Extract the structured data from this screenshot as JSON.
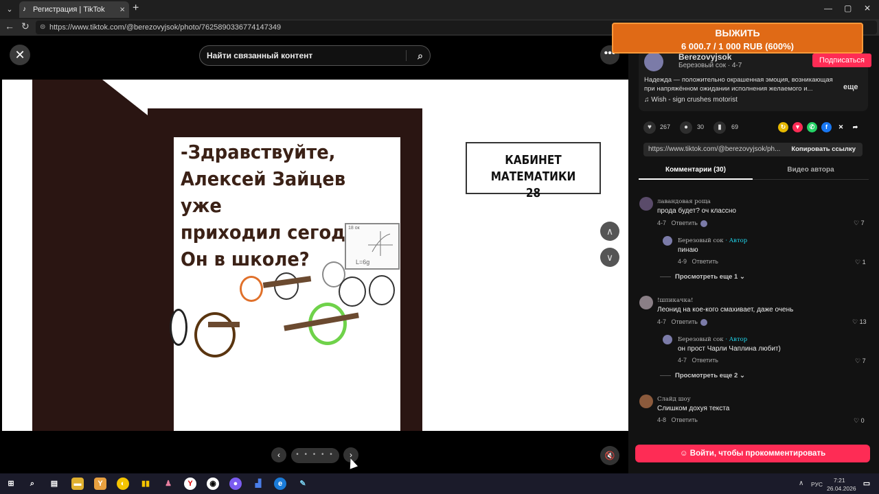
{
  "browser": {
    "tab_title": "Регистрация | TikTok",
    "url": "https://www.tiktok.com/@berezovyjsok/photo/7625890336774147349",
    "new_tab": "+"
  },
  "viewer": {
    "search_placeholder": "Найти связанный контент",
    "speech_lines": [
      "-Здравствуйте,",
      "Алексей Зайцев уже",
      "приходил сегодня?",
      "Он в школе?"
    ],
    "sign_line1": "КАБИНЕТ МАТЕМАТИКИ",
    "sign_line2": "28",
    "board_text": "18 ок",
    "board_formula": "L=6g",
    "pager_dots": "• • • • •"
  },
  "promo": {
    "line1": "ВЫЖИТЬ",
    "line2": "6 000.7 / 1 000 RUB (600%)"
  },
  "author": {
    "name": "Berezovyjsok",
    "sub": "Березовый сок · 4-7",
    "subscribe": "Подписаться",
    "description": "Надежда — положительно окрашенная эмоция, возникающая при напряжённом ожидании исполнения желаемого и...",
    "more": "еще",
    "music": "♫   Wish - sign crushes motorist"
  },
  "stats": {
    "likes": "267",
    "comments": "30",
    "saves": "69"
  },
  "link": {
    "url": "https://www.tiktok.com/@berezovyjsok/ph...",
    "copy": "Копировать ссылку"
  },
  "tabs": {
    "comments": "Комментарии (30)",
    "author_videos": "Видео автора"
  },
  "comments": [
    {
      "user": "лавандовая роща",
      "text": "прода будет? оч классно",
      "date": "4-7",
      "reply": "Ответить",
      "likes": "7"
    },
    {
      "user": "Березовый сок",
      "author": " · Автор",
      "text": "пинаю",
      "date": "4-9",
      "reply": "Ответить",
      "likes": "1"
    },
    {
      "view_more": "Просмотреть еще 1"
    },
    {
      "user": "!шпикачка!",
      "text": "Леонид на кое-кого смахивает, даже очень",
      "date": "4-7",
      "reply": "Ответить",
      "likes": "13"
    },
    {
      "user": "Березовый сок",
      "author": " · Автор",
      "text": "он прост Чарли Чаплина любит)",
      "date": "4-7",
      "reply": "Ответить",
      "likes": "7"
    },
    {
      "view_more": "Просмотреть еще 2"
    },
    {
      "user": "Слайд шоу",
      "text": "Слишком дохуя текста",
      "date": "4-8",
      "reply": "Ответить",
      "likes": "0"
    }
  ],
  "login_button": "Войти, чтобы прокомментировать",
  "taskbar": {
    "lang": "РУС",
    "time": "7:21",
    "date": "26.04.2026"
  }
}
